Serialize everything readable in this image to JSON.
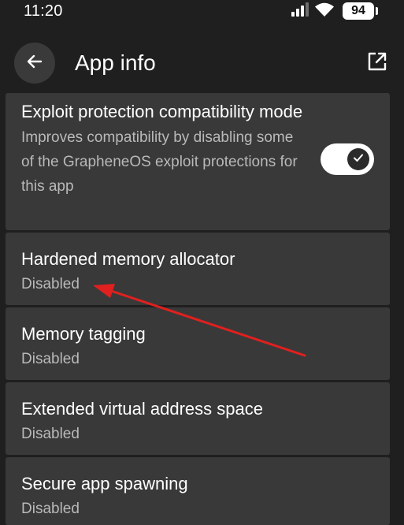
{
  "status_bar": {
    "time": "11:20",
    "battery": "94",
    "icons": [
      "signal-icon",
      "wifi-icon",
      "battery-icon"
    ]
  },
  "top_bar": {
    "title": "App info",
    "back_icon": "arrow-left-icon",
    "open_icon": "open-external-icon"
  },
  "settings": {
    "exploit_protection": {
      "title": "Exploit protection compatibility mode",
      "summary": "Improves compatibility by disabling some of the GrapheneOS exploit protections for this app",
      "toggle_on": true
    },
    "hardened_memory_allocator": {
      "title": "Hardened memory allocator",
      "summary": "Disabled"
    },
    "memory_tagging": {
      "title": "Memory tagging",
      "summary": "Disabled"
    },
    "extended_virtual_address_space": {
      "title": "Extended virtual address space",
      "summary": "Disabled"
    },
    "secure_app_spawning": {
      "title": "Secure app spawning",
      "summary": "Disabled"
    }
  },
  "colors": {
    "background": "#1f1f1f",
    "card": "#393939",
    "summary_text": "#b9b9b9",
    "annotation_arrow": "#e0201f"
  }
}
